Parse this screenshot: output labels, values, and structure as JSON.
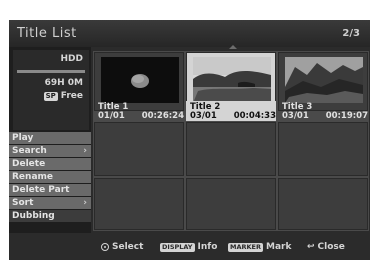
{
  "header": {
    "title": "Title List",
    "page": "2/3"
  },
  "source": {
    "label": "HDD",
    "remaining_time": "69H 0M",
    "mode_badge": "SP",
    "free_label": "Free",
    "usage_fraction": 1.0
  },
  "menu": {
    "items": [
      {
        "label": "Play",
        "has_submenu": false
      },
      {
        "label": "Search",
        "has_submenu": true,
        "chevron": "›"
      },
      {
        "label": "Delete",
        "has_submenu": false
      },
      {
        "label": "Rename",
        "has_submenu": false
      },
      {
        "label": "Delete Part",
        "has_submenu": false
      },
      {
        "label": "Sort",
        "has_submenu": true,
        "chevron": "›"
      },
      {
        "label": "Dubbing",
        "has_submenu": false,
        "selected": true
      }
    ]
  },
  "titles": [
    {
      "name": "Title 1",
      "date": "01/01",
      "duration": "00:26:24",
      "thumbnail": "moon-thumbnail"
    },
    {
      "name": "Title 2",
      "date": "03/01",
      "duration": "00:04:33",
      "thumbnail": "coast-landscape-thumbnail",
      "selected": true
    },
    {
      "name": "Title 3",
      "date": "03/01",
      "duration": "00:19:07",
      "thumbnail": "mountain-landscape-thumbnail"
    }
  ],
  "footer": {
    "select_label": "Select",
    "display_key": "DISPLAY",
    "info_label": "Info",
    "marker_key": "MARKER",
    "mark_label": "Mark",
    "close_label": "Close",
    "select_icon": "circle-enter-icon",
    "close_icon": "return-icon"
  },
  "colors": {
    "background": "#2b2b2b",
    "menu_item": "#6a6a6a",
    "selected_cell": "#d4d4d4",
    "text": "#e0e0e0"
  }
}
